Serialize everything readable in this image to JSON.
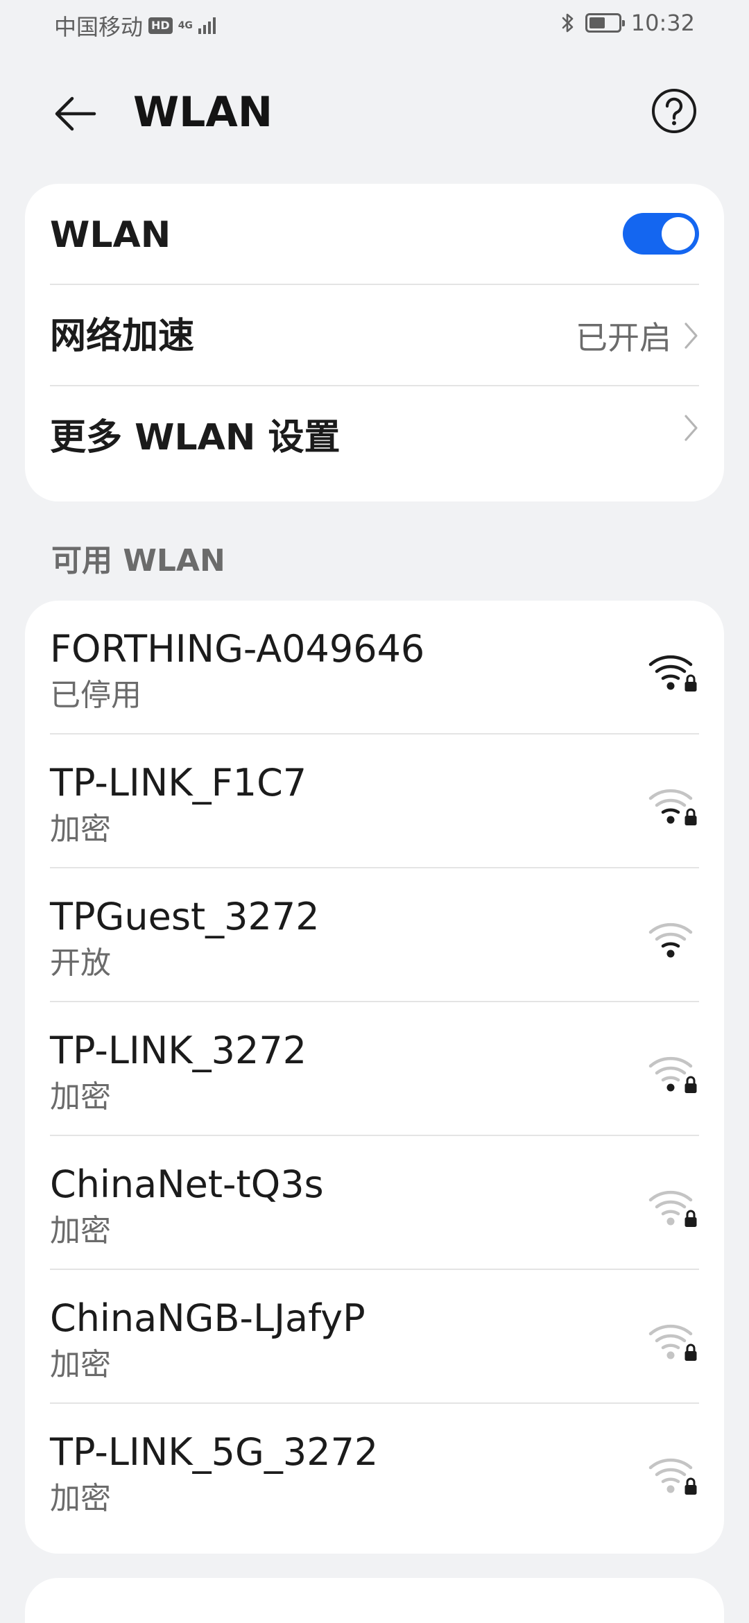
{
  "status_bar": {
    "carrier": "中国移动",
    "hd": "HD",
    "network_type": "4G",
    "time": "10:32",
    "battery_level": 0.55
  },
  "header": {
    "title": "WLAN"
  },
  "settings": {
    "wlan_label": "WLAN",
    "wlan_on": true,
    "accel_label": "网络加速",
    "accel_value": "已开启",
    "more_label": "更多 WLAN 设置"
  },
  "available": {
    "header": "可用 WLAN",
    "networks": [
      {
        "name": "FORTHING-A049646",
        "status": "已停用",
        "strength": 4,
        "locked": true
      },
      {
        "name": "TP-LINK_F1C7",
        "status": "加密",
        "strength": 2,
        "locked": true
      },
      {
        "name": "TPGuest_3272",
        "status": "开放",
        "strength": 2,
        "locked": false
      },
      {
        "name": "TP-LINK_3272",
        "status": "加密",
        "strength": 1,
        "locked": true
      },
      {
        "name": "ChinaNet-tQ3s",
        "status": "加密",
        "strength": 0,
        "locked": true
      },
      {
        "name": "ChinaNGB-LJafyP",
        "status": "加密",
        "strength": 0,
        "locked": true
      },
      {
        "name": "TP-LINK_5G_3272",
        "status": "加密",
        "strength": 0,
        "locked": true
      }
    ]
  },
  "icons": {
    "back": "back-arrow-icon",
    "help": "help-icon",
    "chevron": "chevron-right-icon",
    "wifi": "wifi-signal-icon",
    "lock": "lock-icon",
    "bluetooth": "bluetooth-icon",
    "battery": "battery-icon"
  },
  "colors": {
    "accent": "#1466f0",
    "background": "#f1f2f4",
    "card": "#ffffff",
    "wifi_active": "#1b1b1b",
    "wifi_inactive": "#c4c4c4"
  }
}
